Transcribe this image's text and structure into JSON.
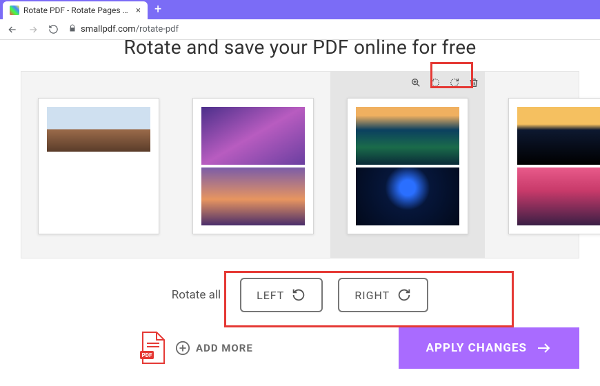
{
  "browser": {
    "tab_title": "Rotate PDF - Rotate Pages Onlin",
    "url_host": "smallpdf.com",
    "url_path": "/rotate-pdf"
  },
  "page": {
    "heading": "Rotate and save your PDF online for free"
  },
  "tools": {
    "zoom": "zoom-in",
    "rotate_left": "rotate-left",
    "rotate_right": "rotate-right",
    "delete": "delete"
  },
  "rotate_all": {
    "label": "Rotate all",
    "left": "LEFT",
    "right": "RIGHT"
  },
  "actions": {
    "add_more": "ADD MORE",
    "apply": "APPLY CHANGES"
  },
  "colors": {
    "accent": "#a96bff",
    "tabstrip": "#7b6cf6",
    "highlight": "#e53935"
  },
  "pages": [
    {
      "selected": false
    },
    {
      "selected": false
    },
    {
      "selected": true
    },
    {
      "selected": false
    }
  ]
}
